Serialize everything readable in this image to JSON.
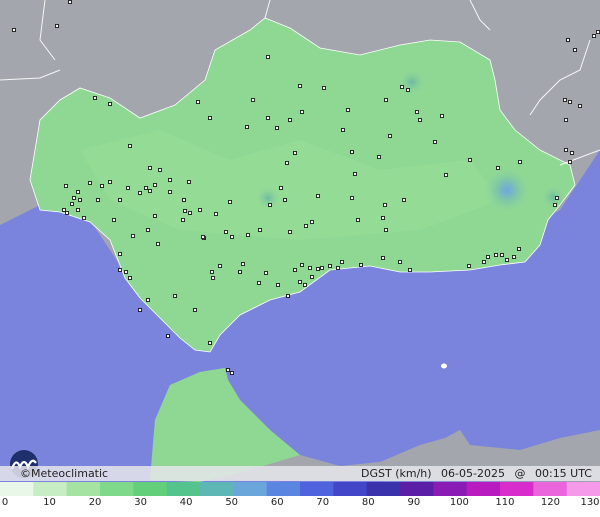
{
  "brand": {
    "name": "Meteoclimatic",
    "copyright": "©"
  },
  "product": {
    "variable": "DGST (km/h)",
    "date": "06-05-2025",
    "at": "@",
    "time": "00:15 UTC"
  },
  "legend": {
    "min": 0,
    "max": 130,
    "ticks": [
      "0",
      "10",
      "20",
      "30",
      "40",
      "50",
      "60",
      "70",
      "80",
      "90",
      "100",
      "110",
      "120",
      "130"
    ],
    "colors": [
      "#e9f7e9",
      "#c7edc4",
      "#a4e3a1",
      "#7fd98b",
      "#63cf7a",
      "#55c48c",
      "#5fb7b5",
      "#6aa6d9",
      "#5a86e2",
      "#4f64dc",
      "#4346c9",
      "#3a32ab",
      "#5a1fa6",
      "#8a1bb5",
      "#b81cc1",
      "#d92ccc",
      "#ea64db",
      "#f49ae8"
    ]
  },
  "colors": {
    "sea": "#7b84dd",
    "land_outside": "#a3a6ad",
    "region": "#8fd894",
    "coast_line": "#ffffff"
  },
  "stations": {
    "count_shown": 160,
    "max_gust_points": [
      {
        "label": "high-gust-east",
        "value_class": "45"
      },
      {
        "label": "local-max-north",
        "value_class": "35"
      },
      {
        "label": "local-max-center",
        "value_class": "35"
      }
    ]
  }
}
